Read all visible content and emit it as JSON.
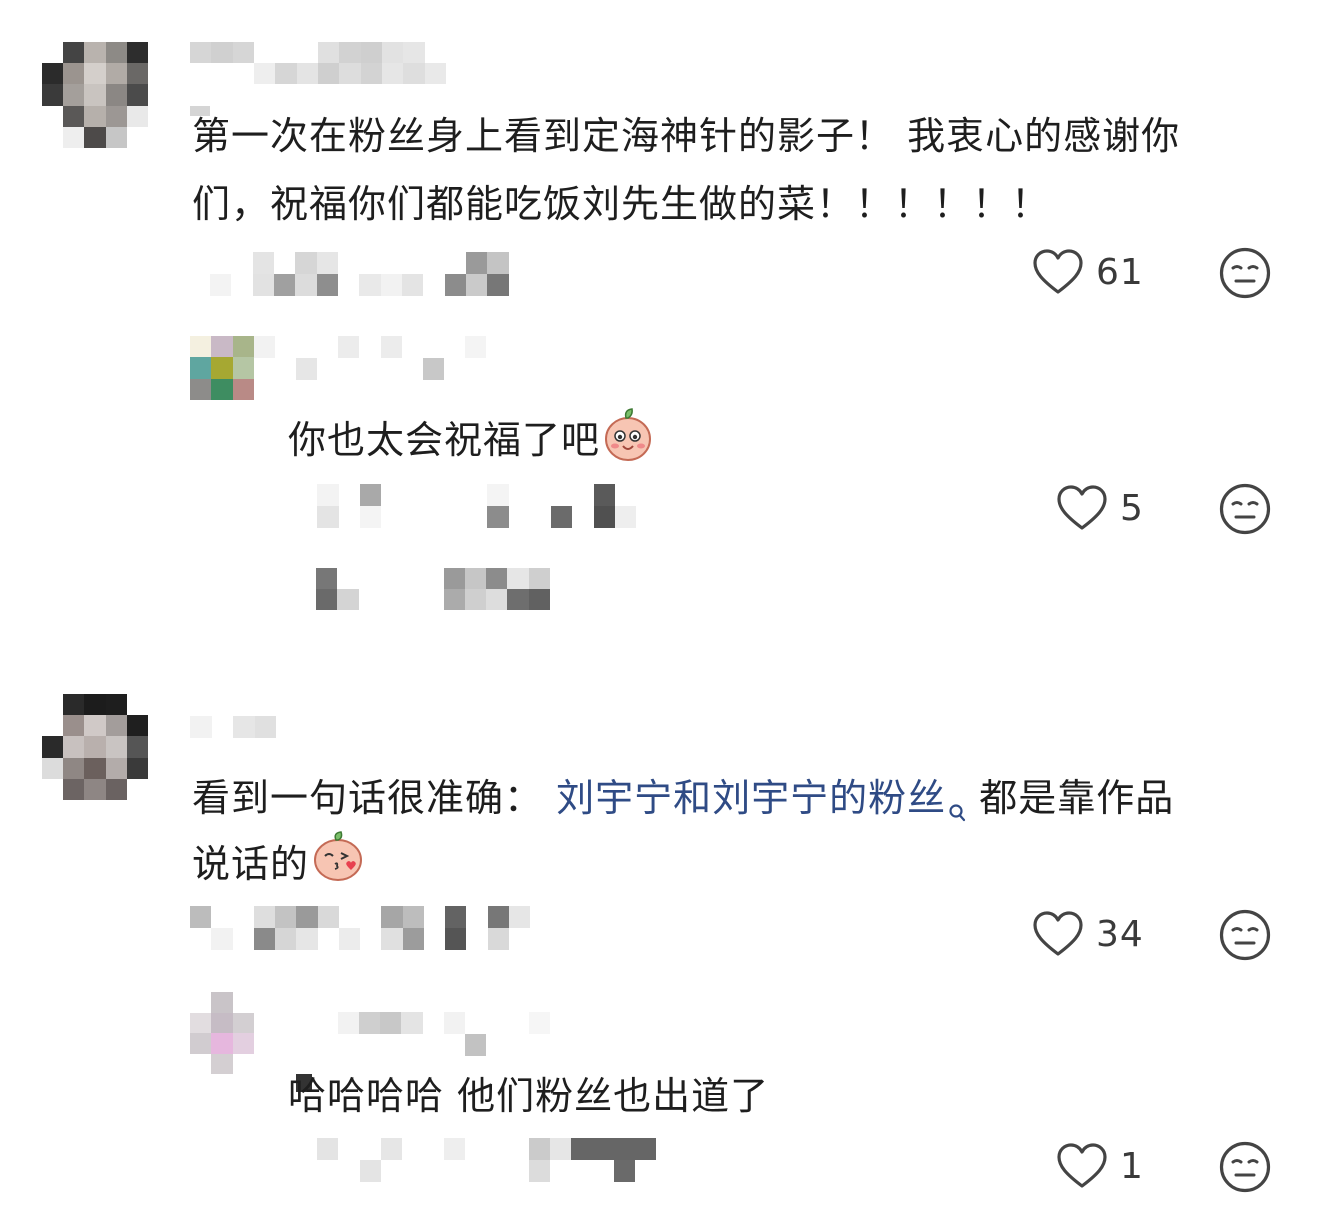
{
  "colors": {
    "text": "#1e1e1e",
    "link": "#2f4b85",
    "icon": "#444444"
  },
  "comments": [
    {
      "text_line1": "第一次在粉丝身上看到定海神针的影子！ 我衷心的感谢你",
      "text_line2": "们，祝福你们都能吃饭刘先生做的菜！！！！！！",
      "like_count": "61",
      "reply": {
        "text": "你也太会祝福了吧",
        "emoji": "blush-peach-emoji",
        "like_count": "5"
      }
    },
    {
      "text_prefix": "看到一句话很准确：",
      "link_text": "刘宇宁和刘宇宁的粉丝",
      "text_suffix": "都是靠作品",
      "text_line2": "说话的",
      "emoji": "kiss-peach-emoji",
      "like_count": "34",
      "reply": {
        "text": "哈哈哈哈 他们粉丝也出道了",
        "like_count": "1"
      }
    }
  ]
}
